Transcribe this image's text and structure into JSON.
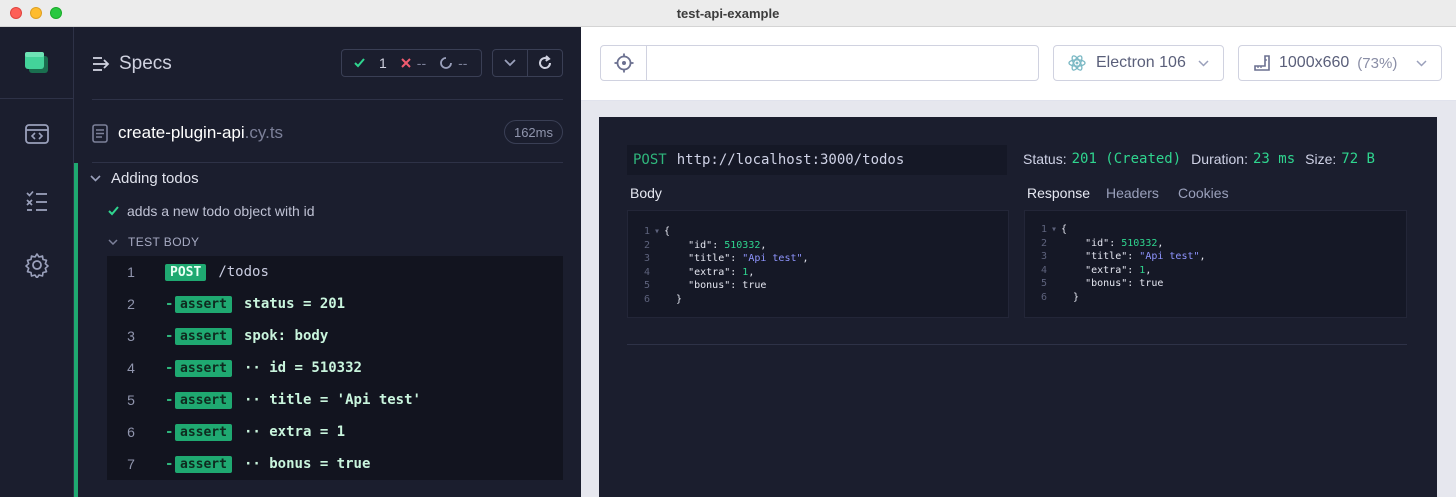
{
  "window": {
    "title": "test-api-example"
  },
  "nav": {
    "items": [
      "runs-icon",
      "specs-icon",
      "settings-icon"
    ]
  },
  "specs": {
    "heading": "Specs",
    "stats": {
      "passed": "1",
      "failed": "--",
      "pending": "--"
    },
    "file": {
      "name": "create-plugin-api",
      "ext": ".cy.ts",
      "duration": "162ms"
    },
    "suite": "Adding todos",
    "test": "adds a new todo object with id",
    "body_label": "TEST BODY",
    "commands": [
      {
        "num": "1",
        "badge": "POST",
        "text": "/todos"
      },
      {
        "num": "2",
        "badge": "assert",
        "text": "status = 201"
      },
      {
        "num": "3",
        "badge": "assert",
        "text": "spok: body"
      },
      {
        "num": "4",
        "badge": "assert",
        "text": "·· id = 510332"
      },
      {
        "num": "5",
        "badge": "assert",
        "text": "·· title = 'Api test'"
      },
      {
        "num": "6",
        "badge": "assert",
        "text": "·· extra = 1"
      },
      {
        "num": "7",
        "badge": "assert",
        "text": "·· bonus = true"
      }
    ]
  },
  "preview": {
    "url": "",
    "browser": "Electron 106",
    "viewport": "1000x660",
    "viewport_scale": "(73%)"
  },
  "request": {
    "method": "POST",
    "url": "http://localhost:3000/todos",
    "status_label": "Status:",
    "status": "201 (Created)",
    "duration_label": "Duration:",
    "duration": "23 ms",
    "size_label": "Size:",
    "size": "72 B",
    "body_label": "Body",
    "tabs": [
      "Response",
      "Headers",
      "Cookies"
    ],
    "body_lines": [
      {
        "ln": "1",
        "fold": "▾",
        "code": "{"
      },
      {
        "ln": "2",
        "fold": "",
        "key": "\"id\"",
        "val": "510332",
        "type": "n",
        "comma": ","
      },
      {
        "ln": "3",
        "fold": "",
        "key": "\"title\"",
        "val": "\"Api test\"",
        "type": "s",
        "comma": ","
      },
      {
        "ln": "4",
        "fold": "",
        "key": "\"extra\"",
        "val": "1",
        "type": "n",
        "comma": ","
      },
      {
        "ln": "5",
        "fold": "",
        "key": "\"bonus\"",
        "val": "true",
        "type": "lit",
        "comma": ""
      },
      {
        "ln": "6",
        "fold": "",
        "code": "}"
      }
    ]
  },
  "colors": {
    "accent": "#1fa971",
    "sidebar": "#1b1e2e",
    "string": "#8f95ff",
    "number": "#2fd58f"
  }
}
